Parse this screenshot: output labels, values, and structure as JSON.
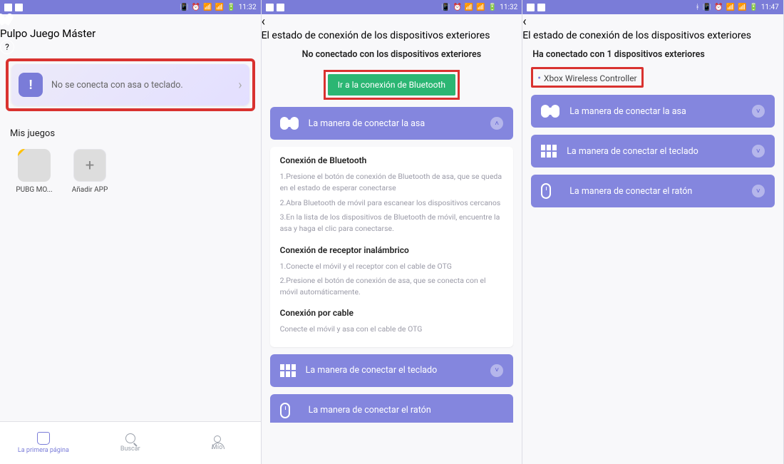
{
  "status": {
    "time_a": "11:32",
    "time_b": "11:32",
    "time_c": "11:47"
  },
  "screen1": {
    "title": "Pulpo Juego Máster",
    "banner_text": "No se conecta con asa o teclado.",
    "my_games_label": "Mis juegos",
    "apps": {
      "pubg": "PUBG MO...",
      "add": "Añadir APP"
    },
    "nav": {
      "home": "La primera página",
      "search": "Buscar",
      "mine": "Mío"
    }
  },
  "screen2": {
    "header": "El estado de conexión de los dispositivos exteriores",
    "not_connected": "No conectado con los dispositivos exteriores",
    "bt_button": "Ir a la conexión de Bluetooth",
    "acc_handle": "La manera de conectar la asa",
    "sec1_title": "Conexión de Bluetooth",
    "sec1_l1": "1.Presione el botón de conexión de Bluetooth de asa, que se queda en el estado de esperar conectarse",
    "sec1_l2": "2.Abra Bluetooth de móvil para escanear los dispositivos cercanos",
    "sec1_l3": "3.En la lista de los dispositivos de Bluetooth de móvil, encuentre la asa y haga el clic para conectarse.",
    "sec2_title": "Conexión de receptor inalámbrico",
    "sec2_l1": "1.Conecte el móvil y el receptor con el cable de OTG",
    "sec2_l2": "2.Presione el botón de conexión de asa, que se conecta con el móvil automáticamente.",
    "sec3_title": "Conexión por cable",
    "sec3_l1": "Conecte el móvil y asa con el cable de OTG",
    "acc_keyboard": "La manera de conectar el teclado",
    "acc_mouse": "La manera de conectar el ratón"
  },
  "screen3": {
    "header": "El estado de conexión de los dispositivos exteriores",
    "connected_line": "Ha conectado con 1 dispositivos exteriores",
    "device": "Xbox Wireless Controller",
    "acc_handle": "La manera de conectar la asa",
    "acc_keyboard": "La manera de conectar el teclado",
    "acc_mouse": "La manera de conectar el ratón"
  }
}
